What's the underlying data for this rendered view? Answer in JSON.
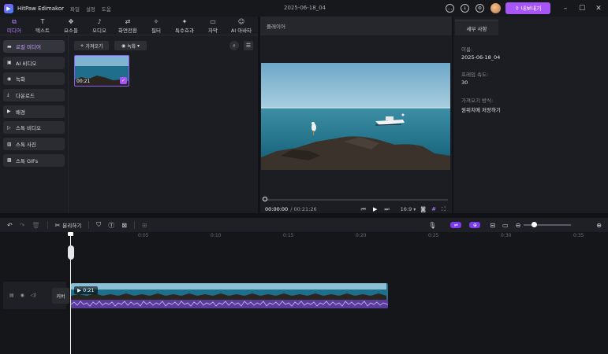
{
  "app": {
    "title": "HitPaw Edimakor",
    "doc_title": "2025-06-18_04"
  },
  "menu": [
    "파일",
    "설정",
    "도움"
  ],
  "header": {
    "export_label": "내보내기"
  },
  "tabs": [
    {
      "label": "미디어",
      "icon": "media-icon",
      "active": true
    },
    {
      "label": "텍스트",
      "icon": "text-icon"
    },
    {
      "label": "요소들",
      "icon": "elements-icon"
    },
    {
      "label": "오디오",
      "icon": "audio-icon"
    },
    {
      "label": "화면전환",
      "icon": "transition-icon"
    },
    {
      "label": "필터",
      "icon": "filter-icon"
    },
    {
      "label": "특수효과",
      "icon": "effects-icon"
    },
    {
      "label": "자막",
      "icon": "subtitle-icon"
    },
    {
      "label": "AI 아바타",
      "icon": "ai-avatar-icon"
    }
  ],
  "sidebar": [
    {
      "label": "로컬 미디어",
      "icon": "folder-icon",
      "active": true
    },
    {
      "label": "AI 비디오",
      "icon": "ai-video-icon"
    },
    {
      "label": "녹화",
      "icon": "record-icon"
    },
    {
      "label": "다운로드",
      "icon": "download-icon"
    },
    {
      "label": "배경",
      "icon": "play-icon"
    },
    {
      "label": "스톡 비디오",
      "icon": "stock-video-icon"
    },
    {
      "label": "스톡 사진",
      "icon": "image-icon"
    },
    {
      "label": "스톡 GIFs",
      "icon": "gif-icon"
    }
  ],
  "media": {
    "import_label": "가져오기",
    "record_label": "녹화",
    "item_duration": "00:21"
  },
  "player": {
    "title": "플레이어",
    "current_time": "00:00:00",
    "total_time": "/ 00:21:26",
    "aspect": "16:9"
  },
  "details": {
    "tab": "세부 사항",
    "name_label": "이름:",
    "name_value": "2025-06-18_04",
    "framerate_label": "프레임 속도:",
    "framerate_value": "30",
    "import_mode_label": "가져오기 방식:",
    "import_mode_value": "원위치에 저장하기"
  },
  "timeline": {
    "split_label": "분리하기",
    "cover_label": "커버",
    "clip_duration": "0:21",
    "ticks": [
      "0:05",
      "0:10",
      "0:15",
      "0:20",
      "0:25",
      "0:30",
      "0:35"
    ]
  },
  "colors": {
    "accent": "#a855f7",
    "background": "#111216",
    "panel": "#1c1d22"
  }
}
